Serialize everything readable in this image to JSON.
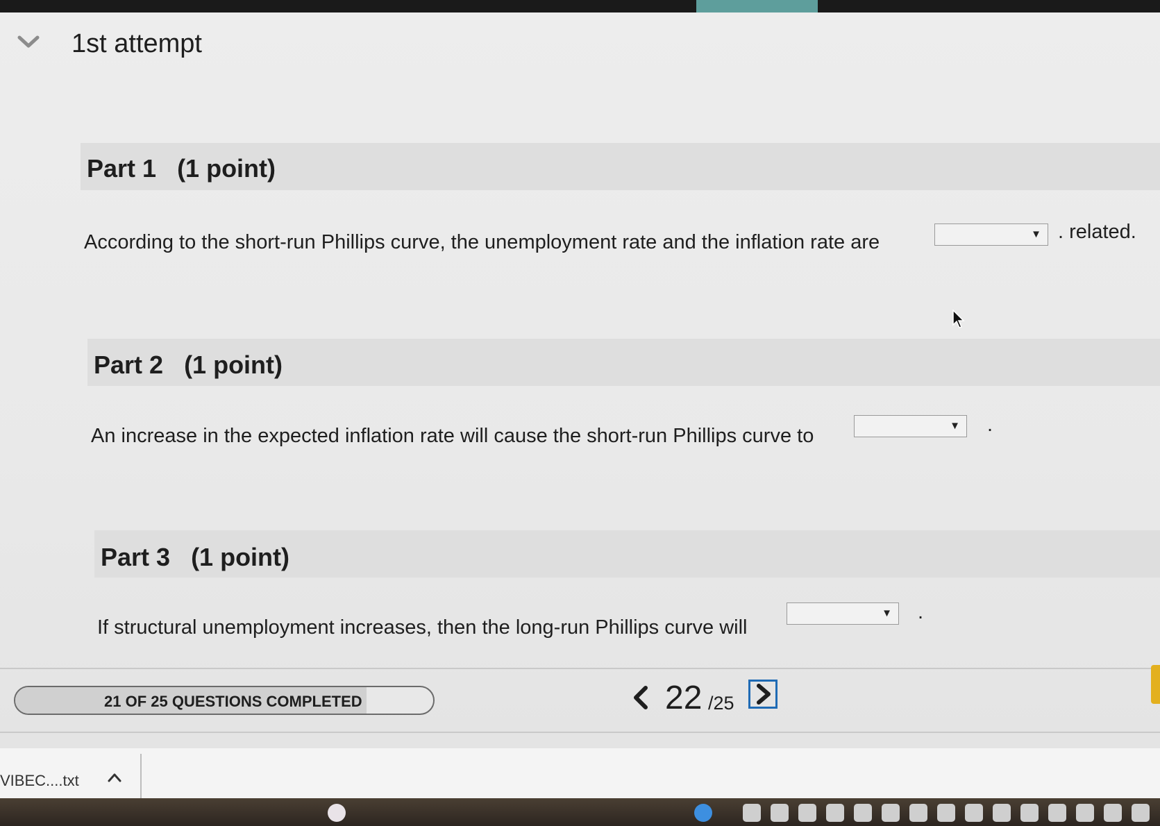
{
  "attempt": {
    "title": "1st attempt"
  },
  "parts": [
    {
      "label": "Part 1",
      "points": "(1 point)",
      "question": "According to the short-run Phillips curve, the unemployment rate and the inflation rate are",
      "after": ". related.",
      "dropdown": {
        "selected": ""
      }
    },
    {
      "label": "Part 2",
      "points": "(1 point)",
      "question": "An increase in the expected inflation rate will cause the short-run Phillips curve to",
      "after": ".",
      "dropdown": {
        "selected": ""
      }
    },
    {
      "label": "Part 3",
      "points": "(1 point)",
      "question": "If structural unemployment increases, then the long-run Phillips curve will",
      "after": ".",
      "dropdown": {
        "selected": ""
      }
    }
  ],
  "progress": {
    "label": "21 OF 25 QUESTIONS COMPLETED",
    "completed": 21,
    "total": 25
  },
  "pager": {
    "current": "22",
    "total": "/25"
  },
  "downloads": {
    "file": "VIBEC....txt"
  },
  "colors": {
    "accent": "#1f6bb5",
    "side_tab": "#e3b01f",
    "top_tab": "#5e9e9c"
  },
  "icons": {
    "collapse": "chevron-down-icon",
    "prev": "chevron-left-icon",
    "next": "chevron-right-icon",
    "dropdown": "triangle-down-icon",
    "downloads": "chevron-up-icon"
  }
}
